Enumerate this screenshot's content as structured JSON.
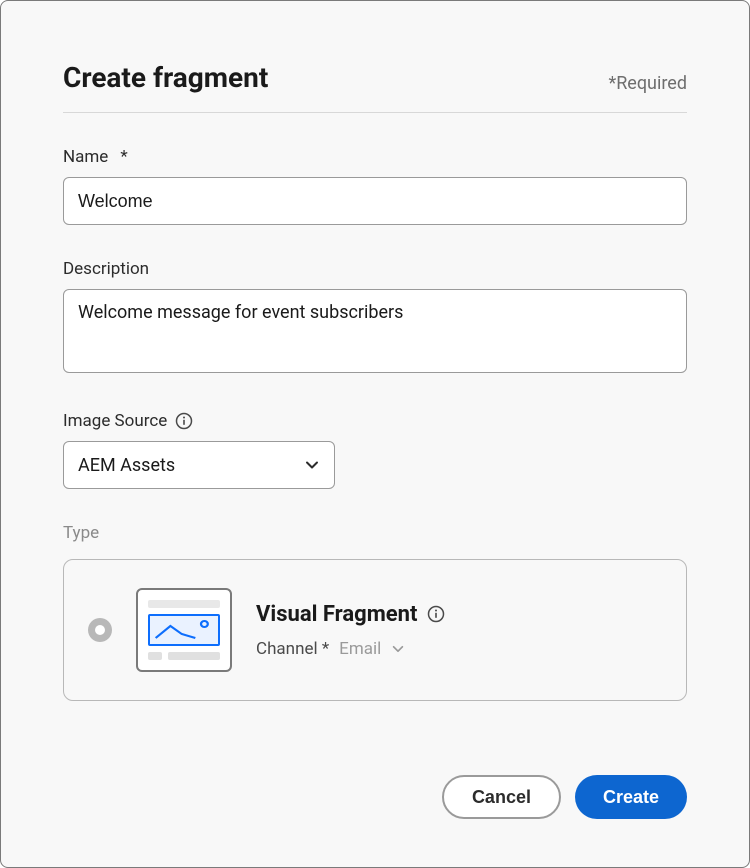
{
  "dialog": {
    "title": "Create fragment",
    "required_note": "*Required"
  },
  "fields": {
    "name": {
      "label": "Name",
      "required_marker": "*",
      "value": "Welcome"
    },
    "description": {
      "label": "Description",
      "value": "Welcome message for event subscribers"
    },
    "image_source": {
      "label": "Image Source",
      "value": "AEM Assets"
    },
    "type": {
      "label": "Type",
      "option": {
        "title": "Visual Fragment",
        "channel_label": "Channel",
        "channel_required_marker": "*",
        "channel_value": "Email"
      }
    }
  },
  "footer": {
    "cancel": "Cancel",
    "create": "Create"
  }
}
